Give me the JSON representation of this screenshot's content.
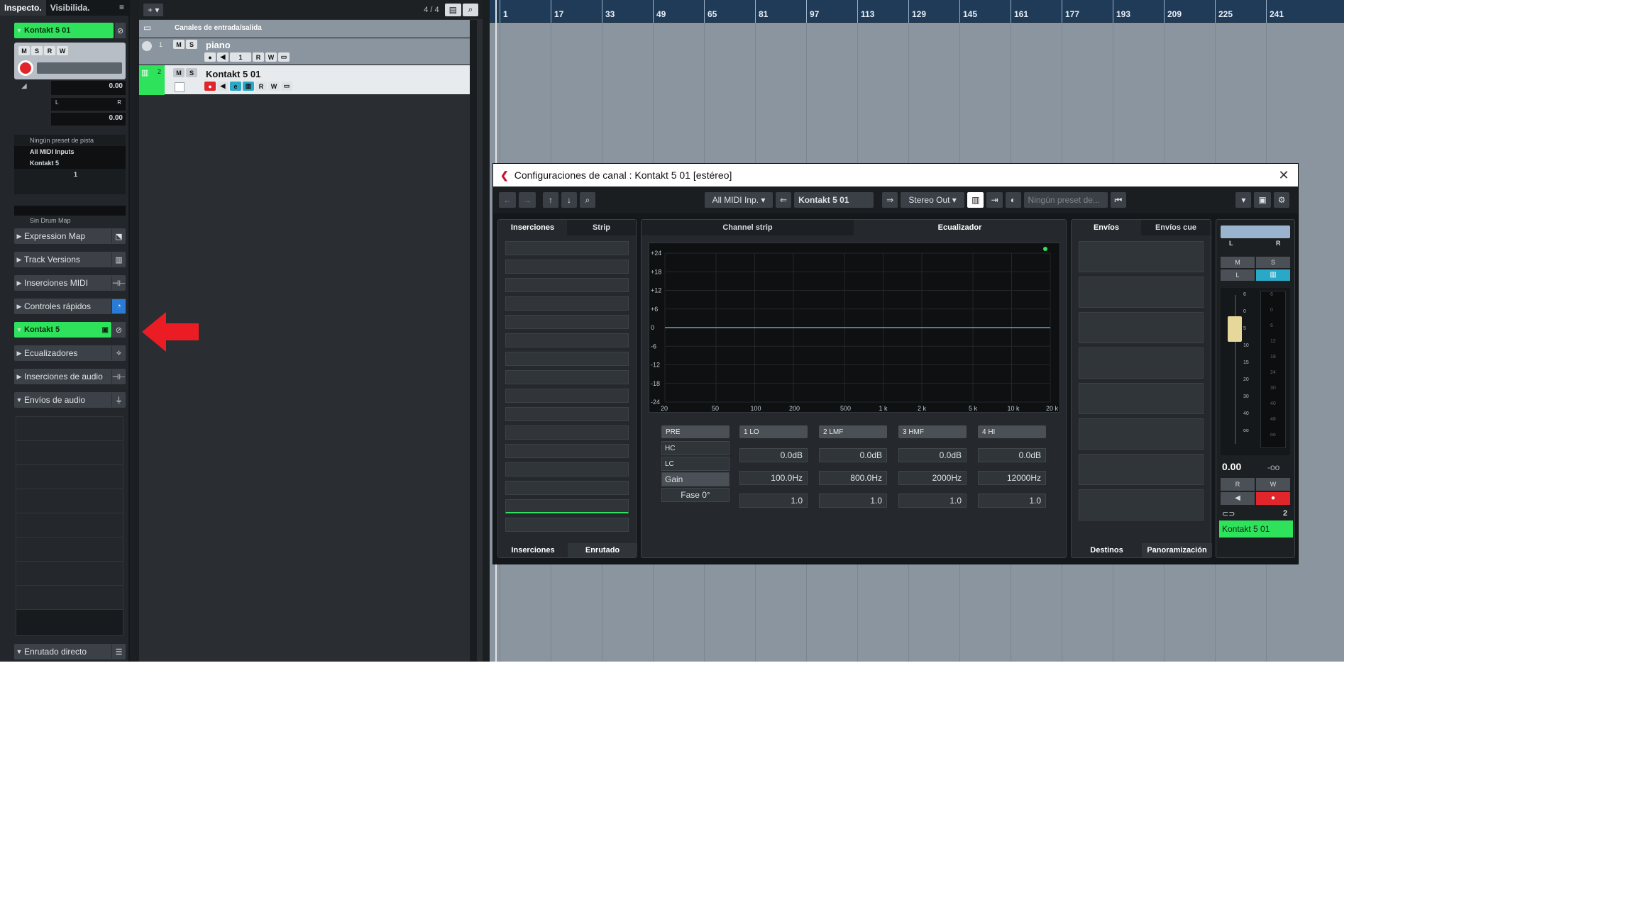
{
  "inspector": {
    "tab_inspector": "Inspecto.",
    "tab_visibility": "Visibilida.",
    "menu": "≡",
    "track_name": "Kontakt 5 01",
    "volume_value": "0.00",
    "pan_value": "0.00",
    "pan_l": "L",
    "pan_r": "R",
    "preset": "Ningún preset de pista",
    "midi_input": "All MIDI Inputs",
    "output": "Kontakt 5",
    "channel": "1",
    "drum_map": "Sin Drum Map",
    "sections": [
      {
        "label": "Expression Map"
      },
      {
        "label": "Track Versions"
      },
      {
        "label": "Inserciones MIDI"
      },
      {
        "label": "Controles rápidos"
      },
      {
        "label": "Kontakt 5"
      },
      {
        "label": "Ecualizadores"
      },
      {
        "label": "Inserciones de audio"
      },
      {
        "label": "Envíos de audio"
      },
      {
        "label": "Enrutado directo"
      }
    ],
    "ms_m": "M",
    "ms_s": "S",
    "ms_r": "R",
    "ms_w": "W"
  },
  "tracklist": {
    "counter": "4 / 4",
    "tracks": [
      {
        "name": "Canales de entrada/salida"
      },
      {
        "name": "piano",
        "number": "1"
      },
      {
        "name": "Kontakt 5 01",
        "number": "2"
      }
    ],
    "m": "M",
    "s": "S",
    "r": "R",
    "w": "W",
    "one": "1"
  },
  "ruler": {
    "bars": [
      "1",
      "17",
      "33",
      "49",
      "65",
      "81",
      "97",
      "113",
      "129",
      "145",
      "161",
      "177",
      "193",
      "209",
      "225",
      "241"
    ]
  },
  "dialog": {
    "title": "Configuraciones de canal : Kontakt 5 01 [estéreo]",
    "close": "✕",
    "midi_input": "All MIDI Inp.",
    "channel_name": "Kontakt 5 01",
    "output": "Stereo Out",
    "preset_placeholder": "Ningún preset de...",
    "inserts_tab": "Inserciones",
    "strip_tab": "Strip",
    "bottom_inserts": "Inserciones",
    "bottom_routing": "Enrutado",
    "channel_strip_tab": "Channel strip",
    "eq_tab": "Ecualizador",
    "eq_y_labels": [
      "+24",
      "+18",
      "+12",
      "+6",
      "0",
      "-6",
      "-12",
      "-18",
      "-24"
    ],
    "eq_x_labels": [
      "20",
      "50",
      "100",
      "200",
      "500",
      "1 k",
      "2 k",
      "5 k",
      "10 k",
      "20 k"
    ],
    "pre_label": "PRE",
    "hc_label": "HC",
    "lc_label": "LC",
    "gain_label": "Gain",
    "phase_label": "Fase 0°",
    "bands": [
      {
        "name": "1 LO",
        "gain": "0.0dB",
        "freq": "100.0Hz",
        "q": "1.0"
      },
      {
        "name": "2 LMF",
        "gain": "0.0dB",
        "freq": "800.0Hz",
        "q": "1.0"
      },
      {
        "name": "3 HMF",
        "gain": "0.0dB",
        "freq": "2000Hz",
        "q": "1.0"
      },
      {
        "name": "4 HI",
        "gain": "0.0dB",
        "freq": "12000Hz",
        "q": "1.0"
      }
    ],
    "sends_tab": "Envíos",
    "cue_sends_tab": "Envíos cue",
    "bottom_destinations": "Destinos",
    "bottom_panning": "Panoramización",
    "fader": {
      "l": "L",
      "r": "R",
      "m": "M",
      "s": "S",
      "listen": "L",
      "value": "0.00",
      "peak": "-oo",
      "rb": "R",
      "wb": "W",
      "number": "2",
      "name": "Kontakt 5 01",
      "scale_left": [
        "6",
        "0",
        "5",
        "10",
        "15",
        "20",
        "30",
        "40",
        "oo"
      ],
      "scale_right": [
        "6",
        "0",
        "6",
        "12",
        "18",
        "24",
        "30",
        "40",
        "48",
        "oo"
      ]
    }
  },
  "colors": {
    "accent_green": "#2ee35b",
    "record_red": "#e0262b",
    "arrow_red": "#ec1c24",
    "ruler_blue": "#1f3b57"
  }
}
